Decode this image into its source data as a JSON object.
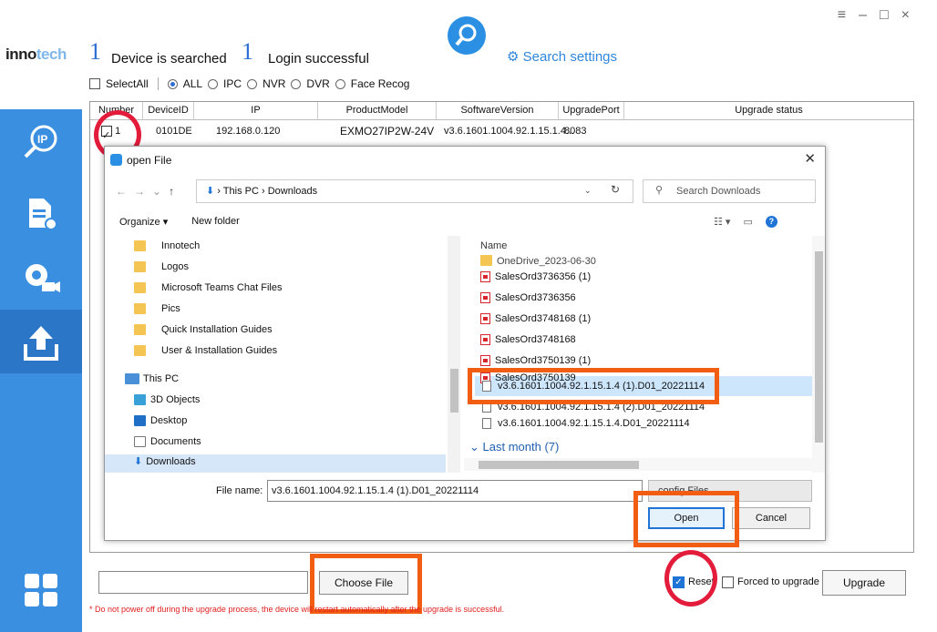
{
  "app": {
    "logo": "innotech",
    "window_controls": [
      "≡",
      "–",
      "□",
      "×"
    ]
  },
  "header": {
    "devices_count": "1",
    "devices_text": "Device is searched",
    "login_count": "1",
    "login_text": "Login successful",
    "search_settings": "Search settings"
  },
  "filters": {
    "select_all": "SelectAll",
    "options": [
      "ALL",
      "IPC",
      "NVR",
      "DVR",
      "Face Recog"
    ],
    "selected": "ALL"
  },
  "table": {
    "columns": [
      "Number",
      "DeviceID",
      "IP",
      "ProductModel",
      "SoftwareVersion",
      "UpgradePort",
      "Upgrade status"
    ],
    "rows": [
      {
        "number": "1",
        "device_id": "0101DE",
        "ip": "192.168.0.120",
        "model": "EXMO27IP2W-24V",
        "version": "v3.6.1601.1004.92.1.15.1.4...",
        "port": "8083",
        "status": ""
      }
    ]
  },
  "dialog": {
    "title": "open File",
    "breadcrumb": "This PC  ›  Downloads",
    "search_placeholder": "Search Downloads",
    "organize": "Organize ▾",
    "new_folder": "New folder",
    "nav_items": [
      "Innotech",
      "Logos",
      "Microsoft Teams Chat Files",
      "Pics",
      "Quick Installation Guides",
      "User & Installation Guides",
      "This PC",
      "3D Objects",
      "Desktop",
      "Documents",
      "Downloads"
    ],
    "name_header": "Name",
    "files": [
      "OneDrive_2023-06-30",
      "SalesOrd3736356 (1)",
      "SalesOrd3736356",
      "SalesOrd3748168 (1)",
      "SalesOrd3748168",
      "SalesOrd3750139 (1)",
      "SalesOrd3750139",
      "v3.6.1601.1004.92.1.15.1.4 (1).D01_20221114",
      "v3.6.1601.1004.92.1.15.1.4 (2).D01_20221114",
      "v3.6.1601.1004.92.1.15.1.4.D01_20221114"
    ],
    "selected_file": "v3.6.1601.1004.92.1.15.1.4 (1).D01_20221114",
    "group_label": "Last month (7)",
    "file_name_label": "File name:",
    "file_name_value": "v3.6.1601.1004.92.1.15.1.4 (1).D01_20221114",
    "file_type": "config Files",
    "open": "Open",
    "cancel": "Cancel"
  },
  "bottom": {
    "choose_file": "Choose File",
    "warning": "* Do not power off during the upgrade process, the device will restart automatically after the upgrade is successful.",
    "reset": "Reset",
    "reset_checked": true,
    "forced": "Forced to upgrade",
    "upgrade": "Upgrade"
  },
  "colors": {
    "sidebar": "#3b8fe0",
    "accent": "#2c6fd0",
    "highlight_box": "#f25d14",
    "highlight_circle": "#e31c3b",
    "warning": "#e02020"
  },
  "icons": [
    "ip-icon",
    "document-settings-icon",
    "camera-settings-icon",
    "upload-icon",
    "dashboard-icon",
    "search-icon",
    "gear-icon"
  ]
}
